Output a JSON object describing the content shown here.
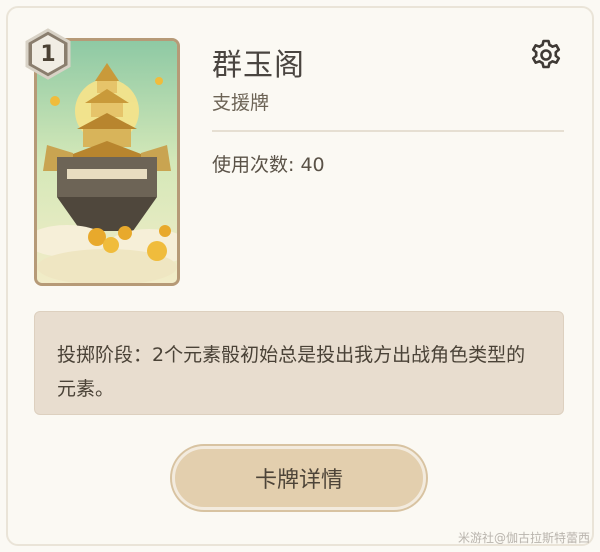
{
  "card": {
    "name": "群玉阁",
    "type_label": "支援牌",
    "usage_text": "使用次数: 40",
    "cost": "1",
    "description": "投掷阶段：2个元素骰初始总是投出我方出战角色类型的元素。",
    "detail_button": "卡牌详情"
  },
  "icons": {
    "settings": "gear-icon",
    "cost": "hexagon-cost-icon"
  },
  "watermark": "米游社@伽古拉斯特蕾西",
  "colors": {
    "background": "#fbf9f4",
    "description_box": "#e8ddcf",
    "button": "#e3cfae",
    "text": "#4a4540"
  }
}
